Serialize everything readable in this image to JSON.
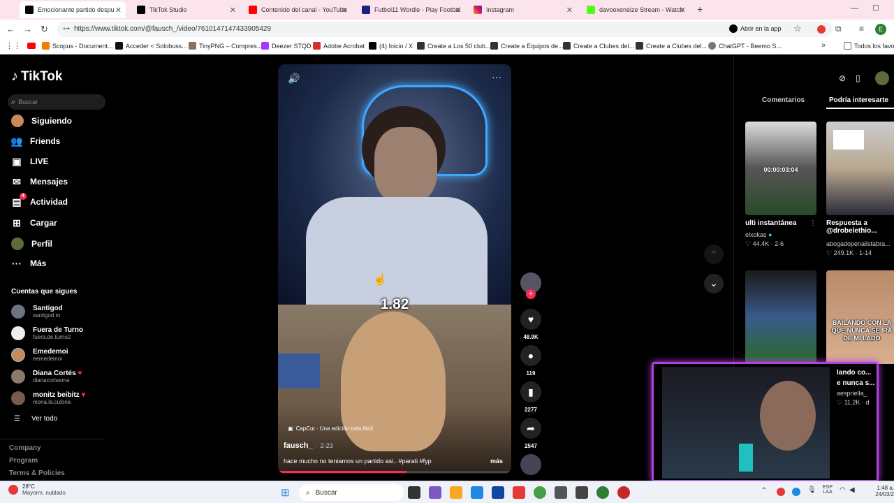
{
  "browser": {
    "tabs": [
      {
        "title": "Emocionante partido despu"
      },
      {
        "title": "TikTok Studio"
      },
      {
        "title": "Contenido del canal - YouTube"
      },
      {
        "title": "Futbol11 Wordle - Play Footbal"
      },
      {
        "title": "Instagram"
      },
      {
        "title": "davooxeneize Stream - Watch"
      }
    ],
    "url": "https://www.tiktok.com/@fausch_/video/7610147147433905429",
    "open_in_app": "Abrir en la app",
    "profile_initial": "E",
    "bookmarks": [
      "Scopus - Document...",
      "Acceder < Solobuss...",
      "TinyPNG – Compres...",
      "Deezer STQD",
      "Adobe Acrobat",
      "(4) Inicio / X",
      "Create a Los 50 club...",
      "Create a Equipos de...",
      "Create a Clubes del...",
      "Create a Clubes del...",
      "ChatGPT - Beemo S..."
    ],
    "bookmarks_all": "Todos los favori"
  },
  "sidebar": {
    "logo": "TikTok",
    "search_placeholder": "Buscar",
    "nav": [
      {
        "label": "Siguiendo"
      },
      {
        "label": "Friends"
      },
      {
        "label": "LIVE"
      },
      {
        "label": "Mensajes"
      },
      {
        "label": "Actividad",
        "badge": "4"
      },
      {
        "label": "Cargar"
      },
      {
        "label": "Perfil"
      },
      {
        "label": "Más"
      }
    ],
    "following_title": "Cuentas que sigues",
    "accounts": [
      {
        "name": "Santigod",
        "handle": "santigod.m"
      },
      {
        "name": "Fuera de Turno",
        "handle": "fuera.de.turno2"
      },
      {
        "name": "Emedemoi",
        "handle": "eemedemoi"
      },
      {
        "name": "Diana Cortés",
        "handle": "dianacortesma"
      },
      {
        "name": "monitz beibitz",
        "handle": "mona.la.culona"
      }
    ],
    "see_all": "Ver todo",
    "footer": [
      "Company",
      "Program",
      "Terms & Policies"
    ]
  },
  "video": {
    "overlay_number": "1.82",
    "capcut": "CapCut · Una edición más fácil",
    "author": "fausch_",
    "date": "2-23",
    "caption": "hace mucho no teniamos un partido asi.. #parati #fyp",
    "more": "más",
    "likes": "48.9K",
    "comments": "119",
    "saves": "2277",
    "shares": "2547"
  },
  "right_panel": {
    "tabs": [
      "Comentarios",
      "Podría interesarte"
    ],
    "items": [
      {
        "title": "ulti instantánea",
        "author": "elxokas",
        "likes": "44.4K",
        "date": "2-6",
        "duration": "00:00:03:04"
      },
      {
        "title": "Respuesta a @drobelethio...",
        "author": "abogadopenalistabra...",
        "likes": "249.1K",
        "date": "1-14"
      },
      {
        "title": "lando co...",
        "subtitle": "e nunca s...",
        "author": "aespriella_",
        "likes": "11.2K",
        "date": "d",
        "overlay": "BAILANDO CON LA QUE NUNCA SE IRÁ DE MI LADO"
      }
    ]
  },
  "taskbar": {
    "weather_temp": "28°C",
    "weather_desc": "Mayorm. nublado",
    "search": "Buscar",
    "lang": "ESP",
    "lang2": "LAA",
    "time": "1:48 a.",
    "date": "24/03/2"
  },
  "colors": {
    "tiktok_red": "#fe2c55",
    "tab_bg": "#fce4ec"
  }
}
